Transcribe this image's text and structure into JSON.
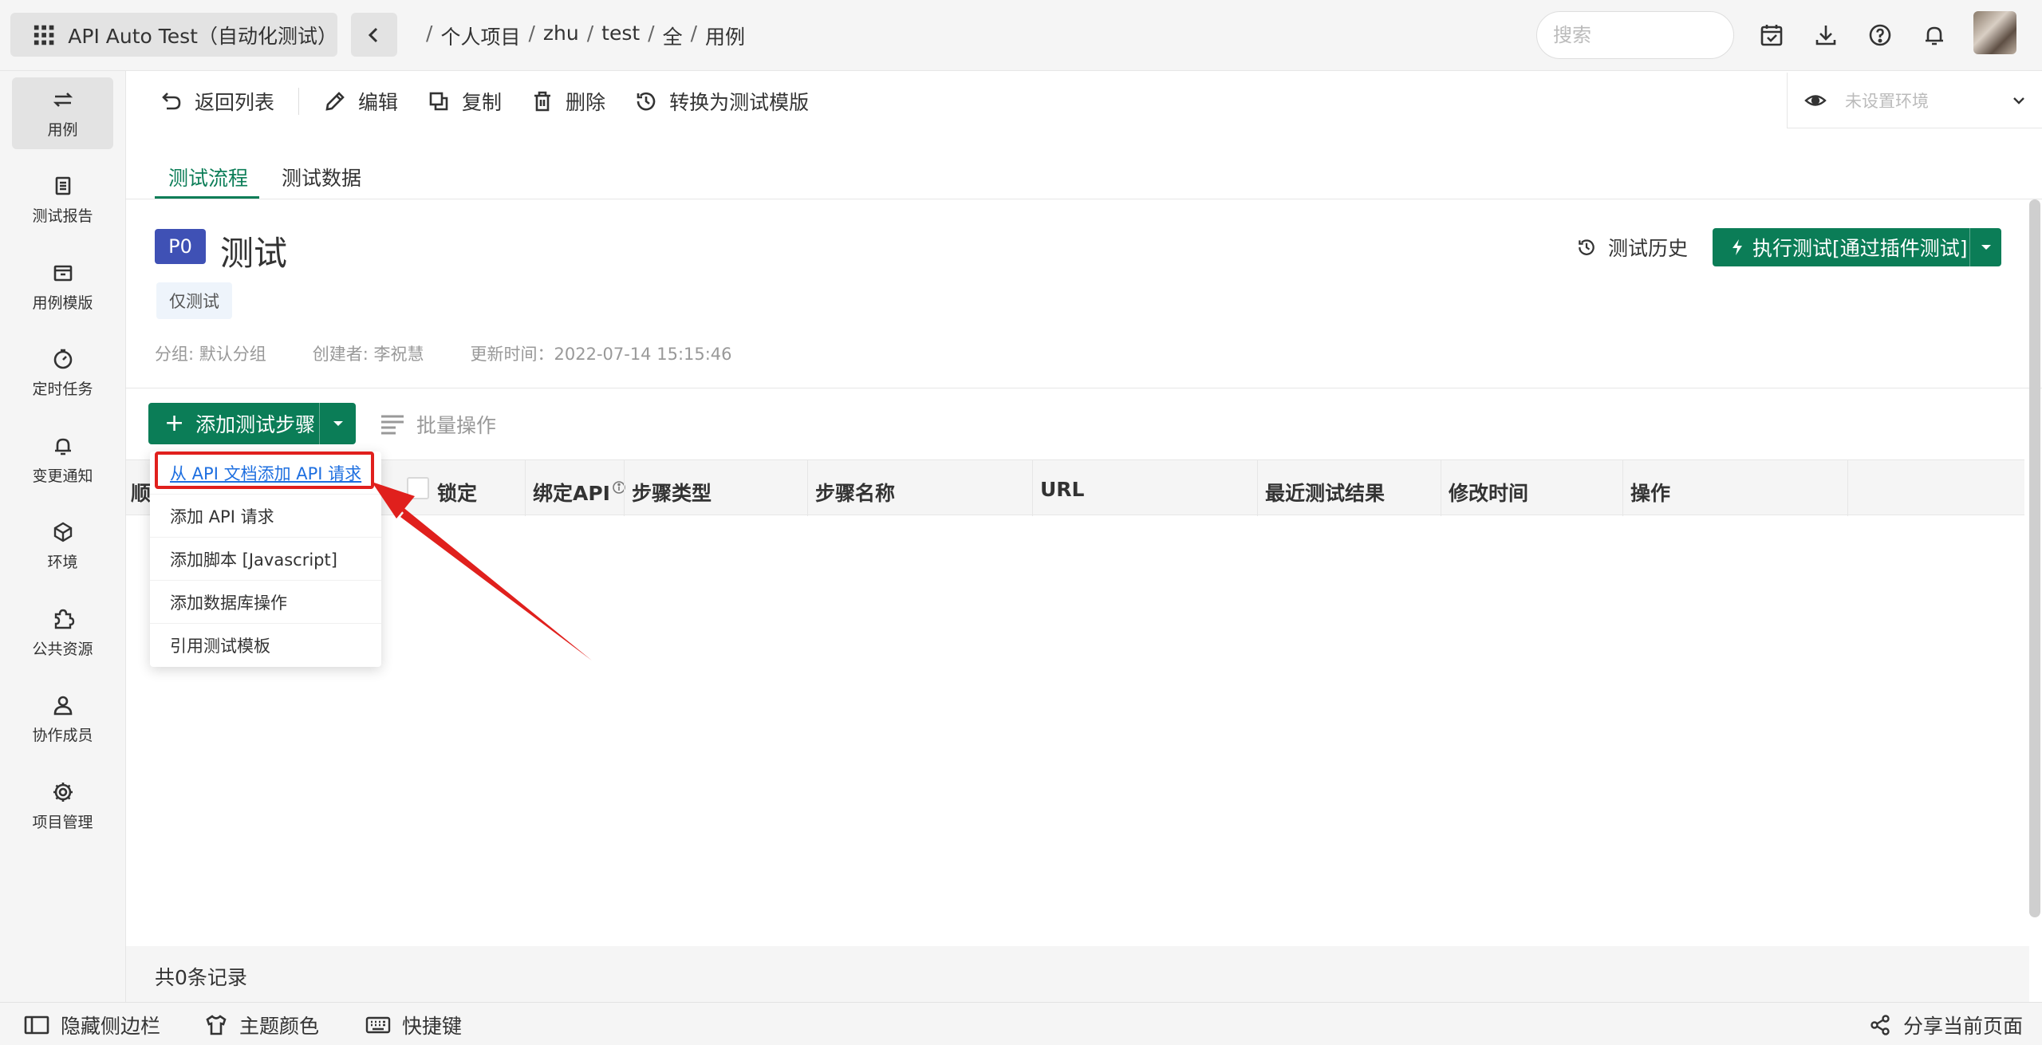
{
  "header": {
    "app_title": "API Auto Test（自动化测试）",
    "breadcrumb": [
      "个人项目",
      "zhu",
      "test",
      "全",
      "用例"
    ],
    "search_placeholder": "搜索"
  },
  "sidebar": {
    "items": [
      {
        "label": "用例",
        "icon": "cases-icon",
        "active": true
      },
      {
        "label": "测试报告",
        "icon": "report-icon"
      },
      {
        "label": "用例模版",
        "icon": "template-icon"
      },
      {
        "label": "定时任务",
        "icon": "timer-icon"
      },
      {
        "label": "变更通知",
        "icon": "bell-icon"
      },
      {
        "label": "环境",
        "icon": "environment-icon"
      },
      {
        "label": "公共资源",
        "icon": "puzzle-icon"
      },
      {
        "label": "协作成员",
        "icon": "members-icon"
      },
      {
        "label": "项目管理",
        "icon": "gear-icon"
      }
    ]
  },
  "toolbar": {
    "back": "返回列表",
    "edit": "编辑",
    "copy": "复制",
    "delete": "删除",
    "convert": "转换为测试模版"
  },
  "environment": {
    "placeholder": "未设置环境"
  },
  "tabs": [
    "测试流程",
    "测试数据"
  ],
  "case": {
    "priority": "P0",
    "title": "测试",
    "tag": "仅测试",
    "group": "分组: 默认分组",
    "creator": "创建者: 李祝慧",
    "updated": "更新时间：2022-07-14 15:15:46"
  },
  "actions": {
    "history": "测试历史",
    "run": "执行测试[通过插件测试]",
    "add_step": "添加测试步骤",
    "batch": "批量操作"
  },
  "table": {
    "headers": [
      "顺",
      "锁定",
      "绑定API",
      "步骤类型",
      "步骤名称",
      "URL",
      "最近测试结果",
      "修改时间",
      "操作"
    ]
  },
  "menu": {
    "items": [
      "从 API 文档添加 API 请求",
      "添加 API 请求",
      "添加脚本 [Javascript]",
      "添加数据库操作",
      "引用测试模板"
    ]
  },
  "footer": {
    "records": "共0条记录",
    "hide_sidebar": "隐藏侧边栏",
    "theme": "主题颜色",
    "shortcuts": "快捷键",
    "share": "分享当前页面"
  },
  "colors": {
    "primary": "#0b7d57",
    "priority": "#3f51b5",
    "highlight": "#e0201d",
    "link": "#1e6fe0"
  }
}
